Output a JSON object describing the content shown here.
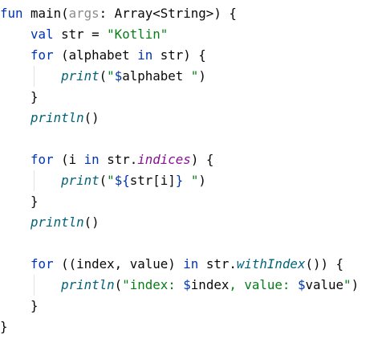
{
  "editor": {
    "language": "Kotlin",
    "theme": "light",
    "lines": [
      {
        "indent": "",
        "guide": false,
        "tokens": [
          {
            "t": "fun ",
            "c": "kw"
          },
          {
            "t": "main",
            "c": "fn"
          },
          {
            "t": "(",
            "c": "p"
          },
          {
            "t": "args",
            "c": "param"
          },
          {
            "t": ": Array<String>) {",
            "c": "p"
          }
        ]
      },
      {
        "indent": "    ",
        "guide": false,
        "tokens": [
          {
            "t": "val ",
            "c": "kw"
          },
          {
            "t": "str = ",
            "c": "p"
          },
          {
            "t": "\"Kotlin\"",
            "c": "str"
          }
        ]
      },
      {
        "indent": "    ",
        "guide": false,
        "tokens": [
          {
            "t": "for ",
            "c": "kw"
          },
          {
            "t": "(alphabet ",
            "c": "p"
          },
          {
            "t": "in ",
            "c": "kw"
          },
          {
            "t": "str) {",
            "c": "p"
          }
        ]
      },
      {
        "indent": "        ",
        "guide": true,
        "tokens": [
          {
            "t": "print",
            "c": "fnit"
          },
          {
            "t": "(",
            "c": "p"
          },
          {
            "t": "\"",
            "c": "str"
          },
          {
            "t": "$",
            "c": "tpl"
          },
          {
            "t": "alphabet",
            "c": "p"
          },
          {
            "t": " \"",
            "c": "str"
          },
          {
            "t": ")",
            "c": "p"
          }
        ]
      },
      {
        "indent": "    ",
        "guide": false,
        "tokens": [
          {
            "t": "}",
            "c": "p"
          }
        ]
      },
      {
        "indent": "    ",
        "guide": false,
        "tokens": [
          {
            "t": "println",
            "c": "fnit"
          },
          {
            "t": "()",
            "c": "p"
          }
        ]
      },
      {
        "indent": "",
        "guide": false,
        "tokens": []
      },
      {
        "indent": "    ",
        "guide": false,
        "tokens": [
          {
            "t": "for ",
            "c": "kw"
          },
          {
            "t": "(i ",
            "c": "p"
          },
          {
            "t": "in ",
            "c": "kw"
          },
          {
            "t": "str.",
            "c": "p"
          },
          {
            "t": "indices",
            "c": "ext"
          },
          {
            "t": ") {",
            "c": "p"
          }
        ]
      },
      {
        "indent": "        ",
        "guide": true,
        "tokens": [
          {
            "t": "print",
            "c": "fnit"
          },
          {
            "t": "(",
            "c": "p"
          },
          {
            "t": "\"",
            "c": "str"
          },
          {
            "t": "${",
            "c": "tpl"
          },
          {
            "t": "str[i]",
            "c": "p"
          },
          {
            "t": "}",
            "c": "tpl"
          },
          {
            "t": " \"",
            "c": "str"
          },
          {
            "t": ")",
            "c": "p"
          }
        ]
      },
      {
        "indent": "    ",
        "guide": false,
        "tokens": [
          {
            "t": "}",
            "c": "p"
          }
        ]
      },
      {
        "indent": "    ",
        "guide": false,
        "tokens": [
          {
            "t": "println",
            "c": "fnit"
          },
          {
            "t": "()",
            "c": "p"
          }
        ]
      },
      {
        "indent": "",
        "guide": false,
        "tokens": []
      },
      {
        "indent": "    ",
        "guide": false,
        "tokens": [
          {
            "t": "for ",
            "c": "kw"
          },
          {
            "t": "((index, value) ",
            "c": "p"
          },
          {
            "t": "in ",
            "c": "kw"
          },
          {
            "t": "str.",
            "c": "p"
          },
          {
            "t": "withIndex",
            "c": "fnit"
          },
          {
            "t": "()) {",
            "c": "p"
          }
        ]
      },
      {
        "indent": "        ",
        "guide": true,
        "tokens": [
          {
            "t": "println",
            "c": "fnit"
          },
          {
            "t": "(",
            "c": "p"
          },
          {
            "t": "\"index: ",
            "c": "str"
          },
          {
            "t": "$",
            "c": "tpl"
          },
          {
            "t": "index",
            "c": "p"
          },
          {
            "t": ", value: ",
            "c": "str"
          },
          {
            "t": "$",
            "c": "tpl"
          },
          {
            "t": "value",
            "c": "p"
          },
          {
            "t": "\"",
            "c": "str"
          },
          {
            "t": ")",
            "c": "p"
          }
        ]
      },
      {
        "indent": "    ",
        "guide": false,
        "tokens": [
          {
            "t": "}",
            "c": "p"
          }
        ]
      },
      {
        "indent": "",
        "guide": false,
        "tokens": [
          {
            "t": "}",
            "c": "p"
          }
        ]
      }
    ]
  }
}
